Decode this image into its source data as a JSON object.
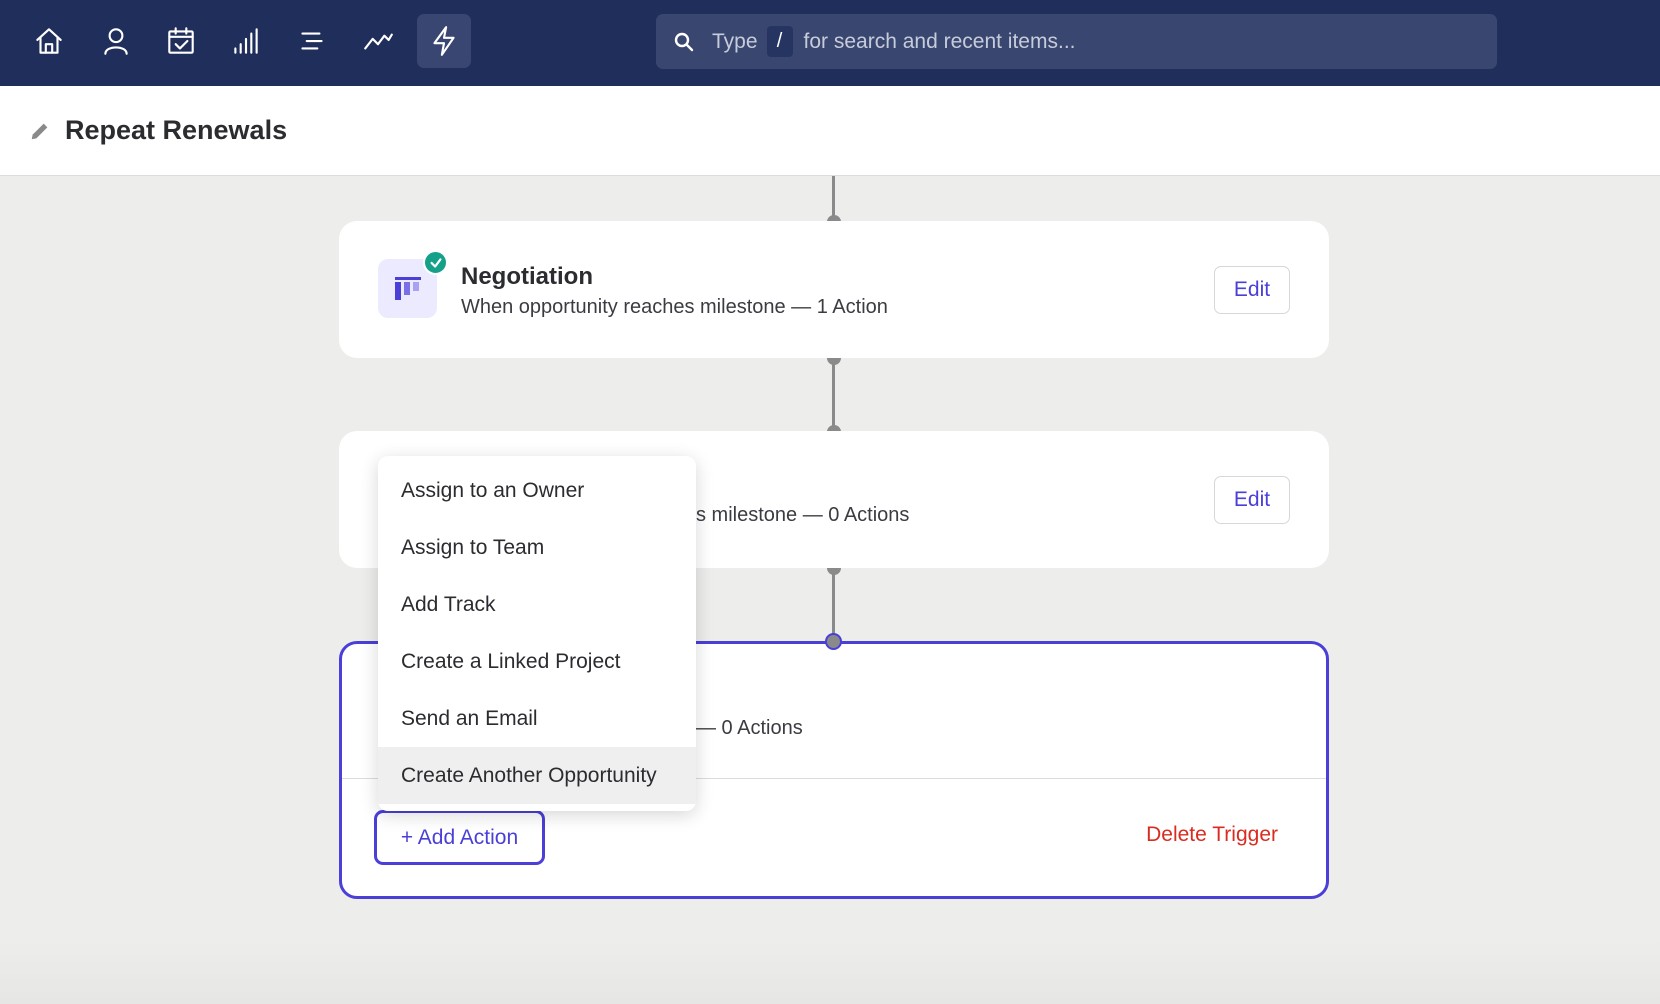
{
  "nav": {
    "items": [
      {
        "icon": "home-icon"
      },
      {
        "icon": "person-icon"
      },
      {
        "icon": "calendar-check-icon"
      },
      {
        "icon": "bar-chart-icon"
      },
      {
        "icon": "list-icon"
      },
      {
        "icon": "trend-line-icon"
      },
      {
        "icon": "lightning-icon",
        "active": true
      }
    ],
    "search": {
      "prefix": "Type",
      "key": "/",
      "suffix": "for search and recent items..."
    }
  },
  "page": {
    "title": "Repeat Renewals",
    "title_icon": "pencil-icon"
  },
  "triggers": [
    {
      "title": "Negotiation",
      "subtitle": "When opportunity reaches milestone — 1 Action",
      "edit_label": "Edit",
      "completed": true
    },
    {
      "subtitle_visible": "s milestone — 0 Actions",
      "edit_label": "Edit"
    },
    {
      "subtitle_visible": "— 0 Actions",
      "add_action_label": "+ Add Action",
      "delete_label": "Delete Trigger"
    }
  ],
  "action_menu": {
    "items": [
      "Assign to an Owner",
      "Assign to Team",
      "Add Track",
      "Create a Linked Project",
      "Send an Email",
      "Create Another Opportunity"
    ],
    "highlighted_index": 5
  },
  "colors": {
    "nav_bg": "#202e5c",
    "accent": "#4a3fd6",
    "danger": "#d92c20",
    "success": "#15a08a"
  }
}
